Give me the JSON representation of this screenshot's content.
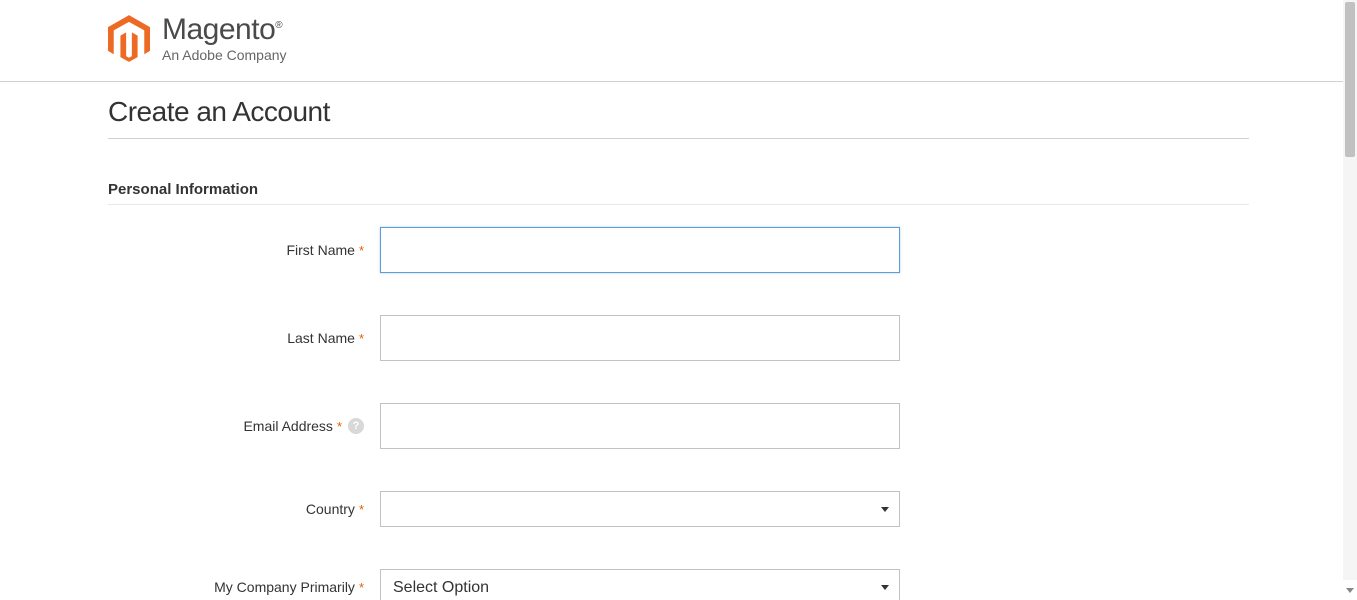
{
  "header": {
    "logo_text": "Magento",
    "logo_subtitle": "An Adobe Company"
  },
  "page": {
    "title": "Create an Account"
  },
  "section": {
    "title": "Personal Information"
  },
  "form": {
    "first_name": {
      "label": "First Name",
      "value": ""
    },
    "last_name": {
      "label": "Last Name",
      "value": ""
    },
    "email": {
      "label": "Email Address",
      "value": ""
    },
    "country": {
      "label": "Country",
      "selected": ""
    },
    "company_primarily": {
      "label": "My Company Primarily",
      "selected": "Select Option"
    }
  },
  "required_marker": "*",
  "help_marker": "?"
}
